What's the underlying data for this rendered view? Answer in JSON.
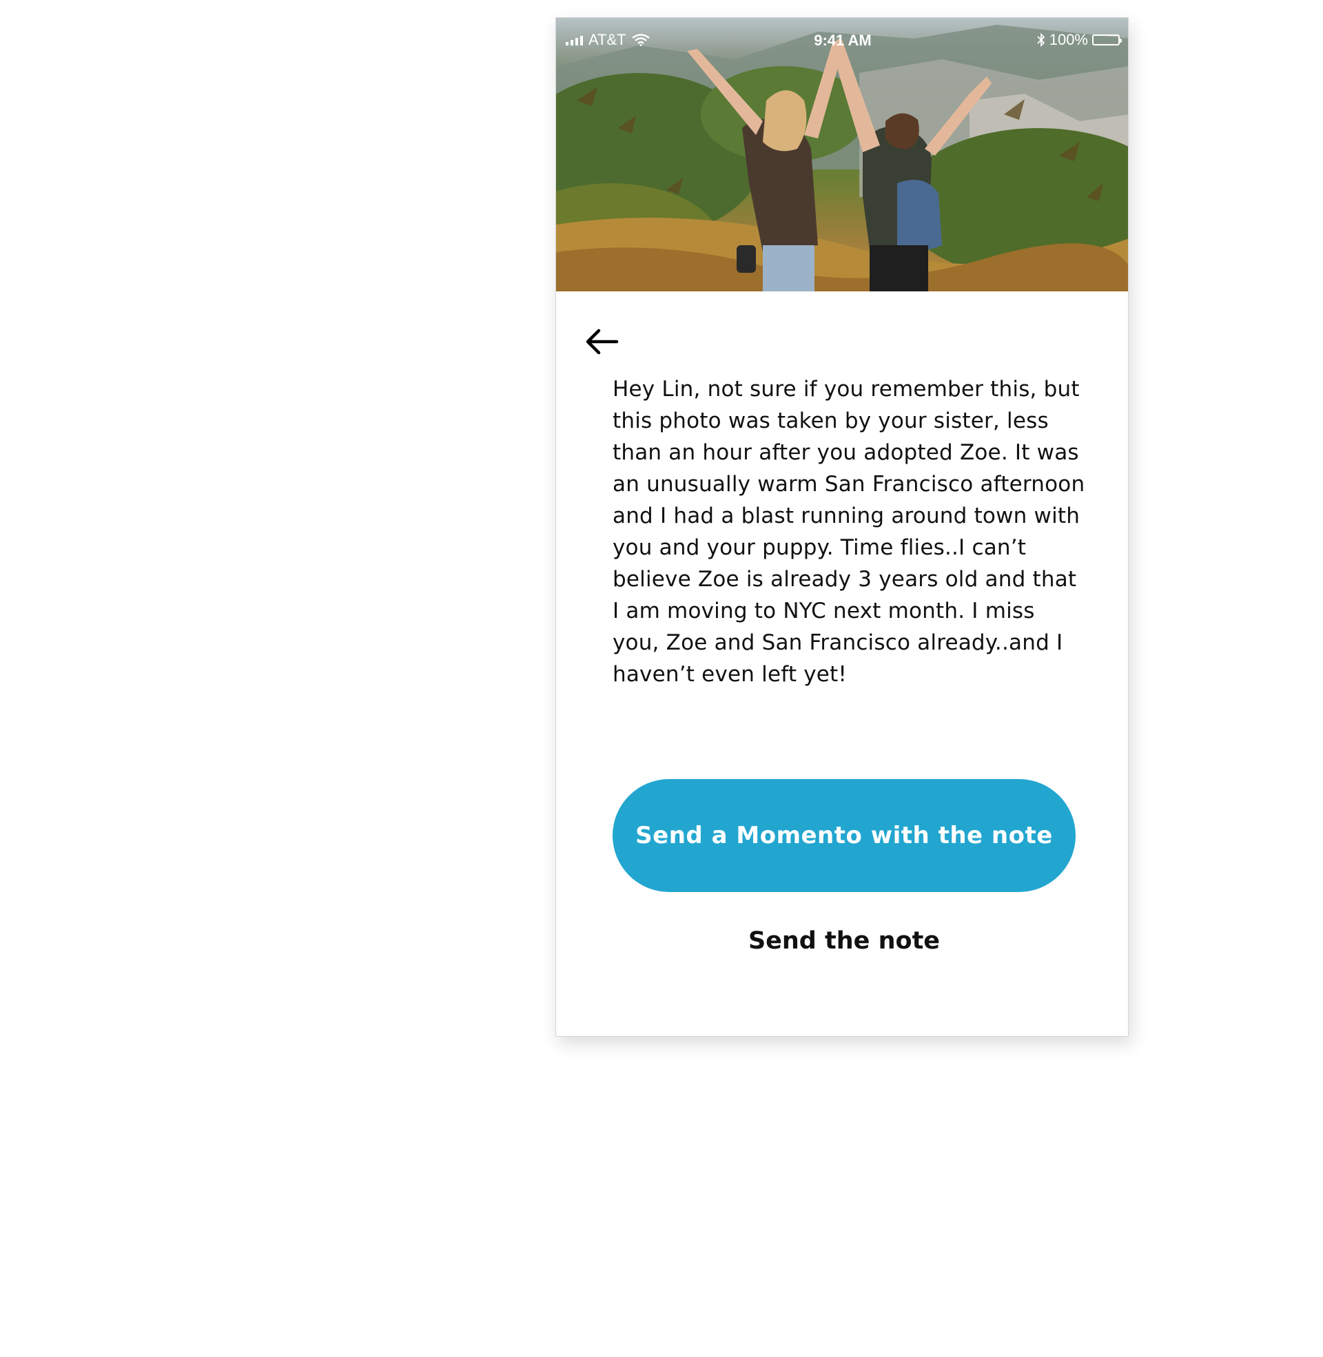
{
  "status_bar": {
    "carrier": "AT&T",
    "time": "9:41 AM",
    "battery": "100%"
  },
  "hero": {
    "icon": "photo-two-hikers-arms-raised"
  },
  "note": {
    "text": "Hey Lin, not sure if you remember this, but this photo was taken by your sister, less than an hour after you adopted Zoe. It was an unusually warm San Francisco afternoon and I had a blast running around town with you and your puppy. Time flies..I can’t believe Zoe is already 3 years old and that I am moving to NYC next month. I miss you, Zoe and San Francisco already..and I haven’t even left yet!"
  },
  "actions": {
    "primary_label": "Send a Momento with the note",
    "secondary_label": "Send the note"
  },
  "colors": {
    "accent": "#22a6d0",
    "text": "#111111",
    "background": "#ffffff"
  }
}
